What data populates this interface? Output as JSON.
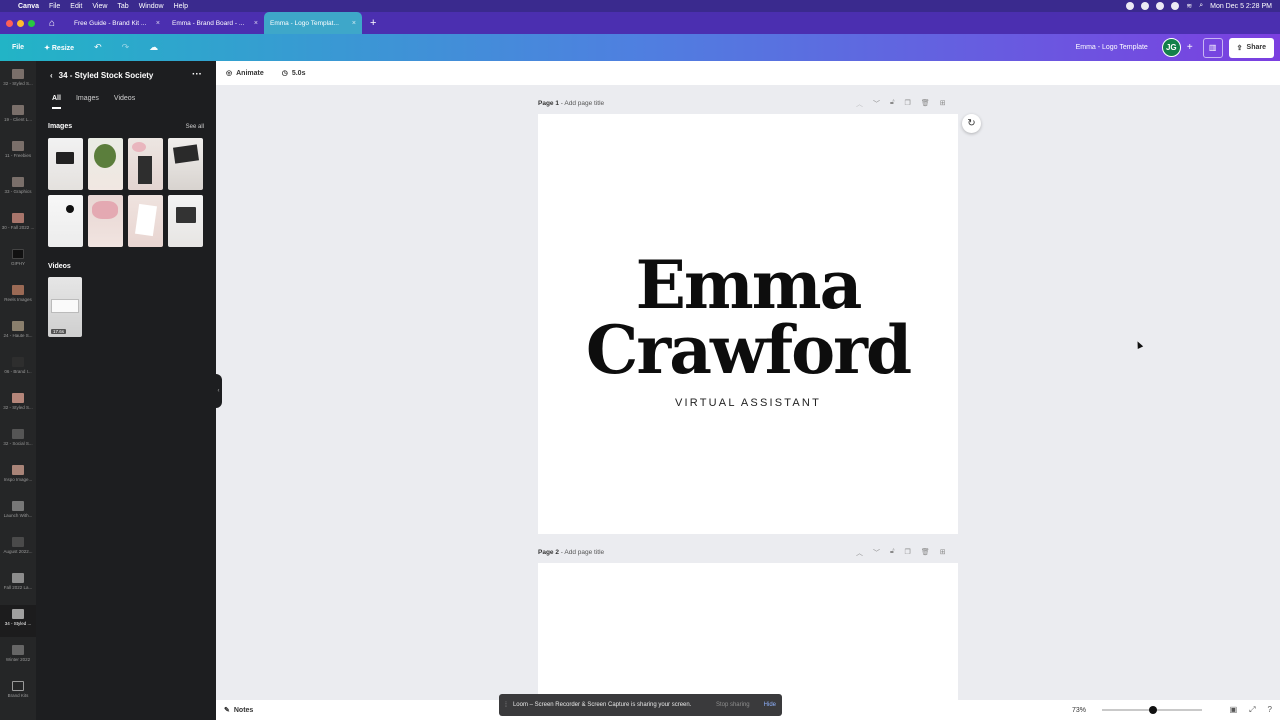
{
  "menubar": {
    "app": "Canva",
    "items": [
      "File",
      "Edit",
      "View",
      "Tab",
      "Window",
      "Help"
    ],
    "datetime": "Mon Dec 5  2:28 PM"
  },
  "tabs": [
    {
      "label": "Free Guide - Brand Kit ..."
    },
    {
      "label": "Emma - Brand Board - ..."
    },
    {
      "label": "Emma - Logo Templat..."
    }
  ],
  "toolbar": {
    "file": "File",
    "resize": "Resize",
    "doc_title": "Emma - Logo Template",
    "avatar_initials": "JG",
    "share": "Share"
  },
  "rail": [
    "32 - Styled S...",
    "19 - Client L...",
    "11 - Freebies",
    "33 - Graphics",
    "30 - Fall 2022 ...",
    "GIPHY",
    "Reels Images",
    "24 - Haute S...",
    "06 - Brand I...",
    "32 - Styled S...",
    "32 - Social S...",
    "Inspo Image...",
    "Launch With...",
    "August 2022...",
    "Fall 2022 La...",
    "34 - Styled ...",
    "Winter 2022",
    "Brand Kits"
  ],
  "panel": {
    "title": "34 - Styled Stock Society",
    "tabs": [
      "All",
      "Images",
      "Videos"
    ],
    "images_title": "Images",
    "see_all": "See all",
    "videos_title": "Videos",
    "video_duration": "17.6s"
  },
  "editor": {
    "animate": "Animate",
    "duration": "5.0s"
  },
  "pages": [
    {
      "label": "Page 1",
      "title_placeholder": "- Add page title"
    },
    {
      "label": "Page 2",
      "title_placeholder": "- Add page title"
    }
  ],
  "logo": {
    "line1": "Emma",
    "line2": "Crawford",
    "subtitle": "VIRTUAL ASSISTANT"
  },
  "loom": {
    "message": "Loom – Screen Recorder & Screen Capture is sharing your screen.",
    "stop": "Stop sharing",
    "hide": "Hide"
  },
  "bottom": {
    "notes": "Notes",
    "zoom": "73%",
    "zoom_level_fraction": 0.73
  }
}
